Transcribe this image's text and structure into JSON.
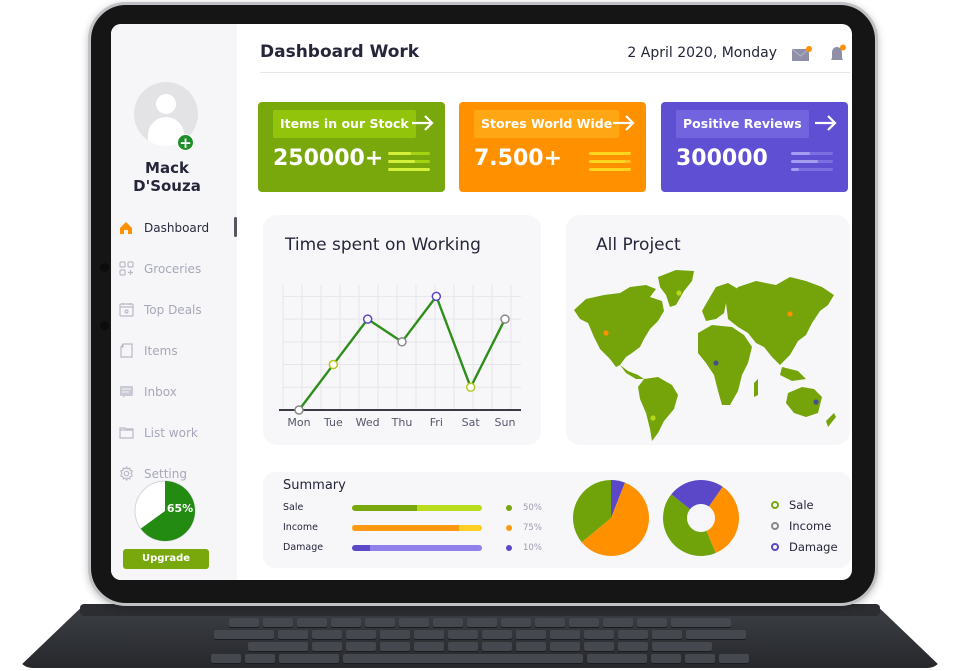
{
  "sidebar": {
    "user_name": "Mack D'Souza",
    "items": [
      {
        "label": "Dashboard",
        "icon": "home-icon",
        "active": true
      },
      {
        "label": "Groceries",
        "icon": "grid-add-icon",
        "active": false
      },
      {
        "label": "Top Deals",
        "icon": "calendar-icon",
        "active": false
      },
      {
        "label": "Items",
        "icon": "document-icon",
        "active": false
      },
      {
        "label": "Inbox",
        "icon": "inbox-icon",
        "active": false
      },
      {
        "label": "List work",
        "icon": "folder-icon",
        "active": false
      },
      {
        "label": "Setting",
        "icon": "gear-icon",
        "active": false
      }
    ],
    "progress": {
      "label": "65%",
      "value": 0.65
    },
    "upgrade_label": "Upgrade"
  },
  "header": {
    "title": "Dashboard Work",
    "date": "2 April 2020, Monday",
    "icons": [
      "mail-icon",
      "bell-icon"
    ]
  },
  "stats": [
    {
      "label": "Items in our Stock",
      "value": "250000+",
      "color": "#79a80c",
      "label_bg": "#93c40c",
      "line_color": "#a6d215",
      "line_fill": "#d4ef3c",
      "fills": [
        0.55,
        0.65,
        1.0
      ]
    },
    {
      "label": "Stores World Wide",
      "value": "7.500+",
      "color": "#ff9000",
      "label_bg": "#ffa614",
      "line_color": "#ffbe1e",
      "line_fill": "#ffd520",
      "fills": [
        1.0,
        0.85,
        1.0
      ]
    },
    {
      "label": "Positive Reviews",
      "value": "300000",
      "color": "#5f4fd2",
      "label_bg": "#7264df",
      "line_color": "#7a6ee0",
      "line_fill": "#a69cf0",
      "fills": [
        0.45,
        0.65,
        0.2
      ]
    }
  ],
  "line_panel": {
    "title": "Time spent on Working"
  },
  "map_panel": {
    "title": "All Project"
  },
  "summary": {
    "title": "Summary",
    "rows": [
      {
        "name": "Sale",
        "percent_label": "50%",
        "value": 0.5,
        "color": "#79a80c",
        "track": "#b9dc1f",
        "dot": "#79a80c"
      },
      {
        "name": "Income",
        "percent_label": "75%",
        "value": 0.82,
        "color": "#ff9a12",
        "track": "#ffcf26",
        "dot": "#ff9a12"
      },
      {
        "name": "Damage",
        "percent_label": "10%",
        "value": 0.14,
        "color": "#5a48c8",
        "track": "#8f80ea",
        "dot": "#5a48c8"
      }
    ],
    "legend": [
      {
        "label": "Sale",
        "color": "#79a80c"
      },
      {
        "label": "Income",
        "color": "#888888"
      },
      {
        "label": "Damage",
        "color": "#5a48c8"
      }
    ]
  },
  "chart_data": [
    {
      "type": "line",
      "title": "Time spent on Working",
      "categories": [
        "Mon",
        "Tue",
        "Wed",
        "Thu",
        "Fri",
        "Sat",
        "Sun"
      ],
      "values": [
        0,
        2,
        4,
        3,
        5,
        1,
        4
      ],
      "marker_colors": [
        "#888888",
        "#b8c81a",
        "#5a48c8",
        "#888888",
        "#5a48c8",
        "#b8c81a",
        "#888888"
      ],
      "line_color": "#2f8f1a",
      "ylim": [
        0,
        5.5
      ],
      "grid": true,
      "xlabel": "",
      "ylabel": ""
    },
    {
      "type": "pie",
      "title": "",
      "slices": [
        {
          "label": "Damage",
          "value": 6,
          "color": "#5a48c8"
        },
        {
          "label": "Income",
          "value": 58,
          "color": "#ff9000"
        },
        {
          "label": "Sale",
          "value": 36,
          "color": "#70a20a"
        }
      ]
    },
    {
      "type": "pie",
      "title": "",
      "donut": true,
      "slices": [
        {
          "label": "Damage",
          "value": 24,
          "color": "#5a48c8"
        },
        {
          "label": "Income",
          "value": 34,
          "color": "#ff9000"
        },
        {
          "label": "Sale",
          "value": 42,
          "color": "#70a20a"
        }
      ]
    }
  ]
}
